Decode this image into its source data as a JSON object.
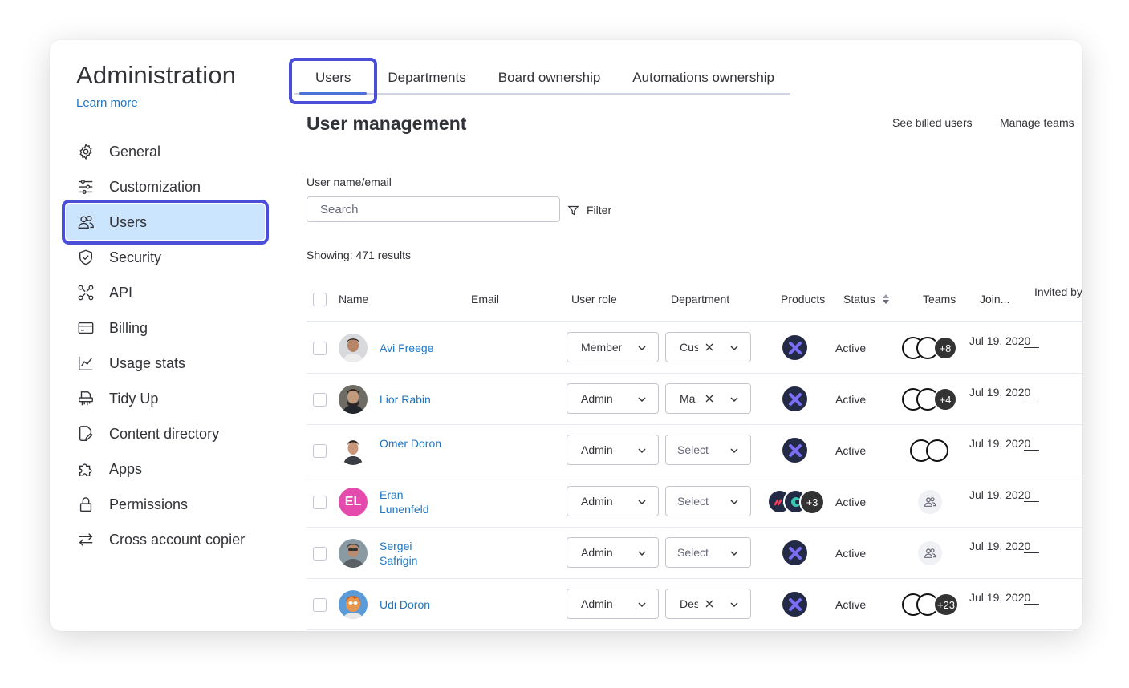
{
  "sidebar": {
    "title": "Administration",
    "learn_more": "Learn more",
    "items": [
      {
        "label": "General",
        "icon": "gear-icon"
      },
      {
        "label": "Customization",
        "icon": "sliders-icon"
      },
      {
        "label": "Users",
        "icon": "users-icon",
        "active": true
      },
      {
        "label": "Security",
        "icon": "shield-icon"
      },
      {
        "label": "API",
        "icon": "api-icon"
      },
      {
        "label": "Billing",
        "icon": "credit-card-icon"
      },
      {
        "label": "Usage stats",
        "icon": "chart-icon"
      },
      {
        "label": "Tidy Up",
        "icon": "shredder-icon"
      },
      {
        "label": "Content directory",
        "icon": "document-edit-icon"
      },
      {
        "label": "Apps",
        "icon": "puzzle-icon"
      },
      {
        "label": "Permissions",
        "icon": "lock-icon"
      },
      {
        "label": "Cross account copier",
        "icon": "swap-arrows-icon"
      }
    ]
  },
  "tabs": [
    "Users",
    "Departments",
    "Board ownership",
    "Automations ownership"
  ],
  "main": {
    "title": "User management",
    "see_billed": "See billed users",
    "manage_teams": "Manage teams",
    "field_label": "User name/email",
    "search_placeholder": "Search",
    "filter_label": "Filter",
    "showing": "Showing: 471 results"
  },
  "table": {
    "headers": {
      "name": "Name",
      "email": "Email",
      "role": "User role",
      "department": "Department",
      "products": "Products",
      "status": "Status",
      "teams": "Teams",
      "joined": "Join...",
      "invited": "Invited by"
    },
    "rows": [
      {
        "name": "Avi Freege",
        "role": "Member",
        "department": "Cus",
        "status": "Active",
        "teams_more": "+8",
        "joined": "Jul 19, 2020",
        "invited_by": "—"
      },
      {
        "name": "Lior Rabin",
        "role": "Admin",
        "department": "Ma",
        "status": "Active",
        "teams_more": "+4",
        "joined": "Jul 19, 2020",
        "invited_by": "—"
      },
      {
        "name": "Omer Doron",
        "role": "Admin",
        "department": "Select",
        "status": "Active",
        "teams_more": "",
        "joined": "Jul 19, 2020",
        "invited_by": "—"
      },
      {
        "name": "Eran Lunenfeld",
        "initials": "EL",
        "role": "Admin",
        "department": "Select",
        "status": "Active",
        "products_more": "+3",
        "teams_more": "",
        "joined": "Jul 19, 2020",
        "invited_by": "—"
      },
      {
        "name": "Sergei Safrigin",
        "role": "Admin",
        "department": "Select",
        "status": "Active",
        "teams_more": "",
        "joined": "Jul 19, 2020",
        "invited_by": "—"
      },
      {
        "name": "Udi Doron",
        "role": "Admin",
        "department": "Des",
        "status": "Active",
        "teams_more": "+23",
        "joined": "Jul 19, 2020",
        "invited_by": "—"
      }
    ]
  },
  "colors": {
    "accent": "#4a4ed8",
    "link": "#1f76c2",
    "active_nav_bg": "#cce5ff",
    "el_avatar": "#e44bad"
  }
}
